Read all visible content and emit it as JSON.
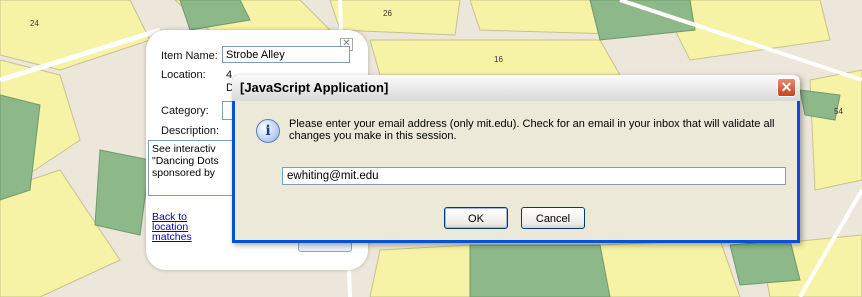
{
  "map": {
    "numbers": [
      "24",
      "26",
      "16",
      "54"
    ]
  },
  "popup": {
    "item_name_label": "Item Name:",
    "item_name_value": "Strobe Alley",
    "location_label": "Location:",
    "location_value_partial": [
      "4",
      "D"
    ],
    "category_label": "Category:",
    "description_label": "Description:",
    "description_lines": [
      "See interactiv",
      "\"Dancing Dots",
      "sponsored by"
    ],
    "back_link": "Back to location matches"
  },
  "dialog": {
    "title": "[JavaScript Application]",
    "message": "Please enter your email address (only mit.edu). Check for an email in your inbox that will validate all changes you make in this session.",
    "input_value": "ewhiting@mit.edu",
    "ok_label": "OK",
    "cancel_label": "Cancel",
    "close_glyph": "✕"
  }
}
